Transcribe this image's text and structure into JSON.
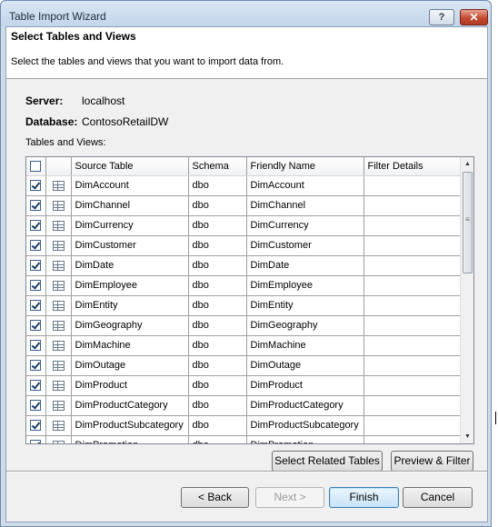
{
  "window": {
    "title": "Table Import Wizard",
    "help_label": "?",
    "close_label": "✕"
  },
  "header": {
    "title": "Select Tables and Views",
    "description": "Select the tables and views that you want to import data from."
  },
  "connection": {
    "server_label": "Server:",
    "server_value": "localhost",
    "database_label": "Database:",
    "database_value": "ContosoRetailDW"
  },
  "grid": {
    "caption": "Tables and Views:",
    "columns": [
      "Source Table",
      "Schema",
      "Friendly Name",
      "Filter Details"
    ],
    "rows": [
      {
        "checked": true,
        "source": "DimAccount",
        "schema": "dbo",
        "friendly": "DimAccount",
        "filter": ""
      },
      {
        "checked": true,
        "source": "DimChannel",
        "schema": "dbo",
        "friendly": "DimChannel",
        "filter": ""
      },
      {
        "checked": true,
        "source": "DimCurrency",
        "schema": "dbo",
        "friendly": "DimCurrency",
        "filter": ""
      },
      {
        "checked": true,
        "source": "DimCustomer",
        "schema": "dbo",
        "friendly": "DimCustomer",
        "filter": ""
      },
      {
        "checked": true,
        "source": "DimDate",
        "schema": "dbo",
        "friendly": "DimDate",
        "filter": ""
      },
      {
        "checked": true,
        "source": "DimEmployee",
        "schema": "dbo",
        "friendly": "DimEmployee",
        "filter": ""
      },
      {
        "checked": true,
        "source": "DimEntity",
        "schema": "dbo",
        "friendly": "DimEntity",
        "filter": ""
      },
      {
        "checked": true,
        "source": "DimGeography",
        "schema": "dbo",
        "friendly": "DimGeography",
        "filter": ""
      },
      {
        "checked": true,
        "source": "DimMachine",
        "schema": "dbo",
        "friendly": "DimMachine",
        "filter": ""
      },
      {
        "checked": true,
        "source": "DimOutage",
        "schema": "dbo",
        "friendly": "DimOutage",
        "filter": ""
      },
      {
        "checked": true,
        "source": "DimProduct",
        "schema": "dbo",
        "friendly": "DimProduct",
        "filter": ""
      },
      {
        "checked": true,
        "source": "DimProductCategory",
        "schema": "dbo",
        "friendly": "DimProductCategory",
        "filter": ""
      },
      {
        "checked": true,
        "source": "DimProductSubcategory",
        "schema": "dbo",
        "friendly": "DimProductSubcategory",
        "filter": ""
      },
      {
        "checked": true,
        "source": "DimPromotion",
        "schema": "dbo",
        "friendly": "DimPromotion",
        "filter": ""
      }
    ]
  },
  "actions": {
    "select_related": "Select Related Tables",
    "preview_filter": "Preview & Filter"
  },
  "footer": {
    "back": "< Back",
    "next": "Next >",
    "finish": "Finish",
    "cancel": "Cancel"
  },
  "icons": {
    "scroll_up": "scroll-up-arrow-icon",
    "scroll_down": "scroll-down-arrow-icon",
    "table": "table-icon",
    "help": "help-icon",
    "close": "close-icon"
  },
  "colors": {
    "window_frame": "#cfdbe9",
    "default_button": "#c9e3f7",
    "close_button": "#c24a32"
  }
}
